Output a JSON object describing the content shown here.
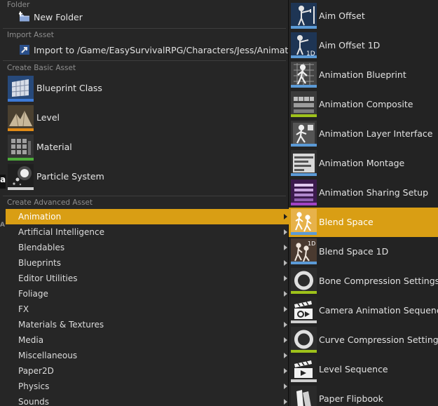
{
  "colors": {
    "accent": "#d99e14",
    "blueprint": "#3d7ad6",
    "level": "#e08a16",
    "material": "#4dab3b",
    "particle": "#cfcfcf",
    "animation": "#5b9ad6",
    "sharing": "#a142c4",
    "bone": "#9ec21a"
  },
  "left_menu": {
    "sections": {
      "folder": "Folder",
      "import": "Import Asset",
      "basic": "Create Basic Asset",
      "advanced": "Create Advanced Asset"
    },
    "new_folder": {
      "label": "New Folder",
      "icon": "new-folder-icon"
    },
    "import_to": {
      "label": "Import to /Game/EasySurvivalRPG/Characters/Jess/Animations...",
      "icon": "import-icon"
    },
    "basic_assets": [
      {
        "label": "Blueprint Class",
        "icon": "blueprint-class-icon"
      },
      {
        "label": "Level",
        "icon": "level-icon"
      },
      {
        "label": "Material",
        "icon": "material-icon"
      },
      {
        "label": "Particle System",
        "icon": "particle-system-icon"
      }
    ],
    "categories": [
      {
        "label": "Animation",
        "selected": true
      },
      {
        "label": "Artificial Intelligence"
      },
      {
        "label": "Blendables"
      },
      {
        "label": "Blueprints"
      },
      {
        "label": "Editor Utilities"
      },
      {
        "label": "Foliage"
      },
      {
        "label": "FX"
      },
      {
        "label": "Materials & Textures"
      },
      {
        "label": "Media"
      },
      {
        "label": "Miscellaneous"
      },
      {
        "label": "Paper2D"
      },
      {
        "label": "Physics"
      },
      {
        "label": "Sounds"
      }
    ],
    "edge_fragments": [
      "a",
      "A"
    ]
  },
  "submenu": {
    "items": [
      {
        "label": "Aim Offset",
        "icon": "aim-offset-icon"
      },
      {
        "label": "Aim Offset 1D",
        "icon": "aim-offset-1d-icon",
        "badge": "1D"
      },
      {
        "label": "Animation Blueprint",
        "icon": "animation-blueprint-icon"
      },
      {
        "label": "Animation Composite",
        "icon": "animation-composite-icon"
      },
      {
        "label": "Animation Layer Interface",
        "icon": "animation-layer-interface-icon"
      },
      {
        "label": "Animation Montage",
        "icon": "animation-montage-icon"
      },
      {
        "label": "Animation Sharing Setup",
        "icon": "animation-sharing-setup-icon"
      },
      {
        "label": "Blend Space",
        "icon": "blend-space-icon",
        "selected": true
      },
      {
        "label": "Blend Space 1D",
        "icon": "blend-space-1d-icon",
        "badge": "1D"
      },
      {
        "label": "Bone Compression Settings",
        "icon": "bone-compression-icon"
      },
      {
        "label": "Camera Animation Sequence",
        "icon": "camera-animation-icon"
      },
      {
        "label": "Curve Compression Settings",
        "icon": "curve-compression-icon"
      },
      {
        "label": "Level Sequence",
        "icon": "level-sequence-icon"
      },
      {
        "label": "Paper Flipbook",
        "icon": "paper-flipbook-icon"
      }
    ]
  }
}
